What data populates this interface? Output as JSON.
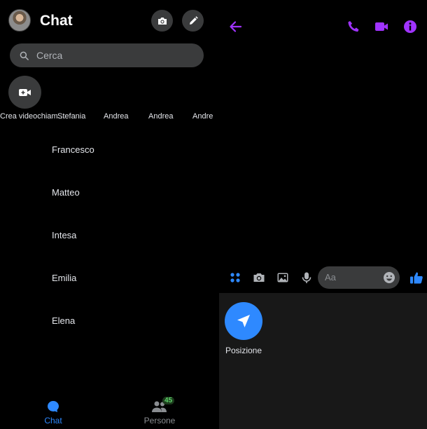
{
  "header": {
    "title": "Chat"
  },
  "search": {
    "placeholder": "Cerca"
  },
  "stories": {
    "create_label": "Crea videochiam…",
    "people": [
      "Stefania",
      "Andrea",
      "Andrea",
      "Andre"
    ]
  },
  "chats": [
    "Francesco",
    "Matteo",
    "Intesa",
    "Emilia",
    "Elena"
  ],
  "bottom_nav": {
    "chat_label": "Chat",
    "people_label": "Persone",
    "people_badge": "45"
  },
  "composer": {
    "placeholder": "Aa"
  },
  "tray": {
    "position_label": "Posizione"
  },
  "colors": {
    "accent_purple": "#a033ff",
    "accent_blue": "#2e89ff",
    "badge_green": "#5ed16a"
  }
}
